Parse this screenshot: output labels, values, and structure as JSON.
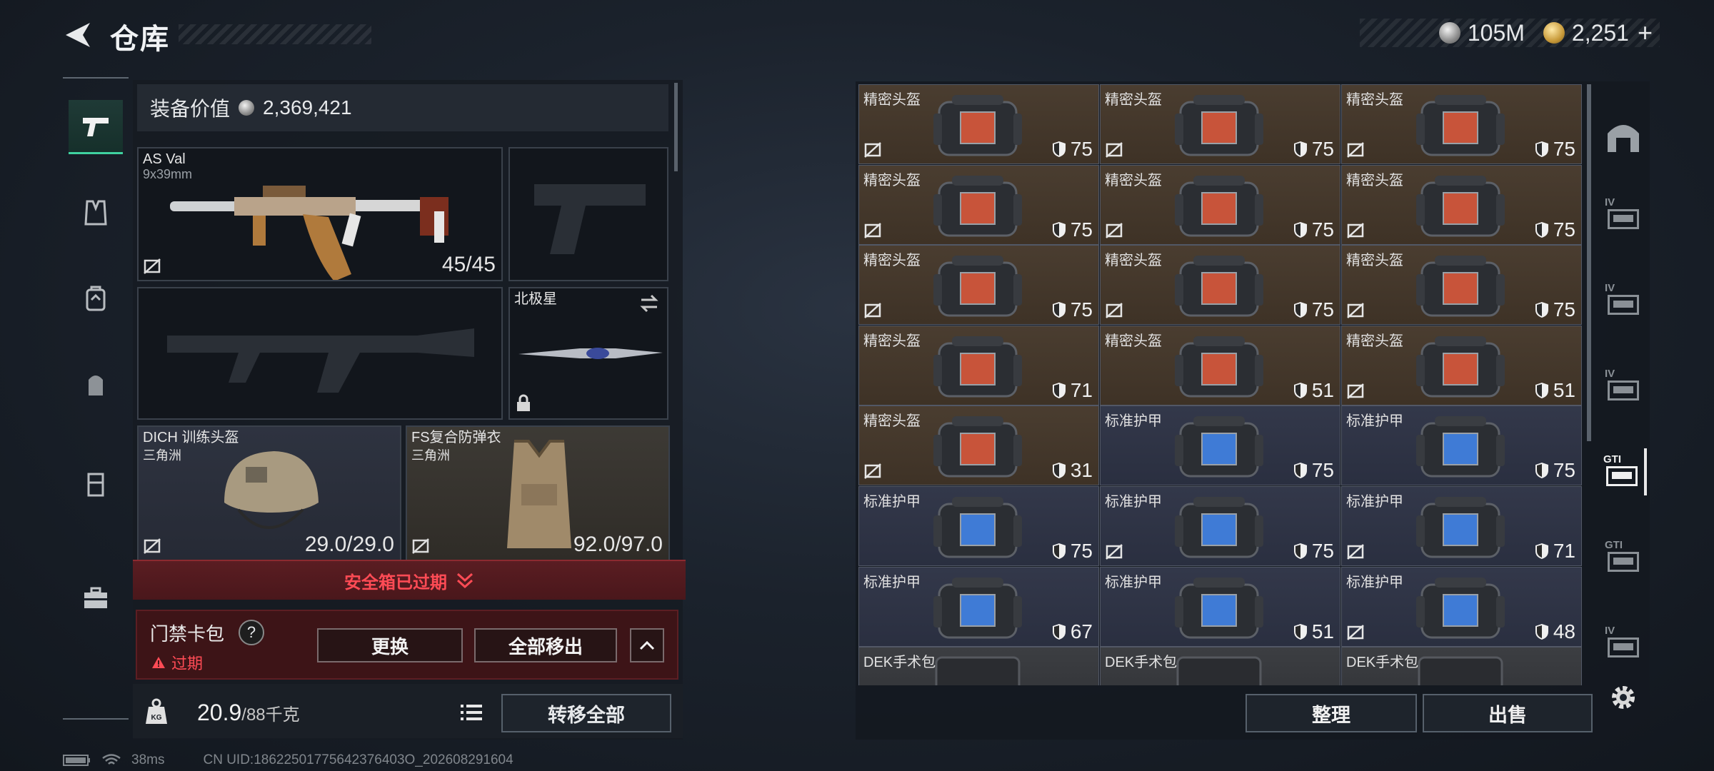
{
  "header": {
    "title": "仓库",
    "currency_silver": "105M",
    "currency_gold": "2,251",
    "plus": "+"
  },
  "equipment": {
    "value_label": "装备价值",
    "value": "2,369,421",
    "primary_weapon": {
      "name": "AS Val",
      "caliber": "9x39mm",
      "ammo": "45/45"
    },
    "melee": {
      "name": "北极星"
    },
    "helmet": {
      "name": "DICH 训练头盔",
      "source": "三角洲",
      "durability": "29.0/29.0"
    },
    "armor": {
      "name": "FS复合防弹衣",
      "source": "三角洲",
      "durability": "92.0/97.0"
    }
  },
  "safe_box": {
    "expired_label": "安全箱已过期"
  },
  "keybag": {
    "title": "门禁卡包",
    "help": "?",
    "status": "过期",
    "replace_label": "更换",
    "move_all_label": "全部移出"
  },
  "capacity": {
    "current": "20.9",
    "max": "/88千克",
    "transfer_label": "转移全部",
    "weight_icon": "KG"
  },
  "status_bar": {
    "ping": "38ms",
    "uid": "CN UID:18622501775642376403O_202608291604"
  },
  "stash": {
    "items": [
      {
        "label": "精密头盔",
        "dur": "75",
        "type": "helmet",
        "noswap": true
      },
      {
        "label": "精密头盔",
        "dur": "75",
        "type": "helmet",
        "noswap": true
      },
      {
        "label": "精密头盔",
        "dur": "75",
        "type": "helmet",
        "noswap": true
      },
      {
        "label": "精密头盔",
        "dur": "75",
        "type": "helmet",
        "noswap": true
      },
      {
        "label": "精密头盔",
        "dur": "75",
        "type": "helmet",
        "noswap": true
      },
      {
        "label": "精密头盔",
        "dur": "75",
        "type": "helmet",
        "noswap": true
      },
      {
        "label": "精密头盔",
        "dur": "75",
        "type": "helmet",
        "noswap": true
      },
      {
        "label": "精密头盔",
        "dur": "75",
        "type": "helmet",
        "noswap": true
      },
      {
        "label": "精密头盔",
        "dur": "75",
        "type": "helmet",
        "noswap": true
      },
      {
        "label": "精密头盔",
        "dur": "71",
        "type": "helmet",
        "noswap": false
      },
      {
        "label": "精密头盔",
        "dur": "51",
        "type": "helmet",
        "noswap": false
      },
      {
        "label": "精密头盔",
        "dur": "51",
        "type": "helmet",
        "noswap": true
      },
      {
        "label": "精密头盔",
        "dur": "31",
        "type": "helmet",
        "noswap": true
      },
      {
        "label": "标准护甲",
        "dur": "75",
        "type": "armor",
        "noswap": false
      },
      {
        "label": "标准护甲",
        "dur": "75",
        "type": "armor",
        "noswap": false
      },
      {
        "label": "标准护甲",
        "dur": "75",
        "type": "armor",
        "noswap": false
      },
      {
        "label": "标准护甲",
        "dur": "75",
        "type": "armor",
        "noswap": true
      },
      {
        "label": "标准护甲",
        "dur": "71",
        "type": "armor",
        "noswap": true
      },
      {
        "label": "标准护甲",
        "dur": "67",
        "type": "armor",
        "noswap": false
      },
      {
        "label": "标准护甲",
        "dur": "51",
        "type": "armor",
        "noswap": false
      },
      {
        "label": "标准护甲",
        "dur": "48",
        "type": "armor",
        "noswap": true
      },
      {
        "label": "DEK手术包",
        "dur": "",
        "type": "med",
        "noswap": false
      },
      {
        "label": "DEK手术包",
        "dur": "",
        "type": "med",
        "noswap": false
      },
      {
        "label": "DEK手术包",
        "dur": "",
        "type": "med",
        "noswap": false
      }
    ],
    "sort_label": "整理",
    "sell_label": "出售"
  },
  "right_rail": {
    "tabs": [
      "IV",
      "IV",
      "IV",
      "GTI",
      "GTI",
      "IV"
    ]
  },
  "colors": {
    "accent": "#3fd2a0",
    "warning": "#ff4b55",
    "helmet_bg": "#4a3d30",
    "armor_bg": "#33384a"
  }
}
